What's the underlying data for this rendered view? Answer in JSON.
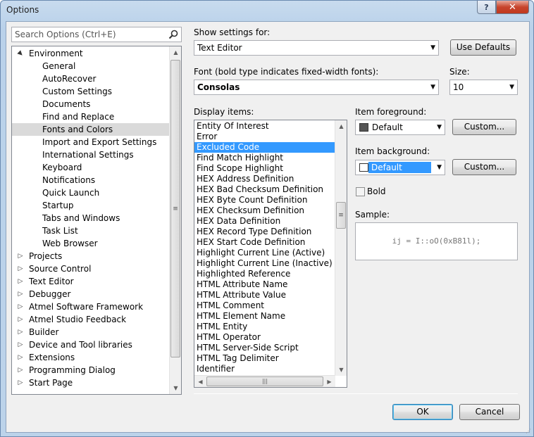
{
  "window": {
    "title": "Options"
  },
  "titlebar": {
    "help_label": "?",
    "close_label": "✕"
  },
  "search": {
    "placeholder": "Search Options (Ctrl+E)"
  },
  "tree": {
    "items": [
      {
        "label": "Environment",
        "level": 0,
        "expander": "▲"
      },
      {
        "label": "General",
        "level": 1
      },
      {
        "label": "AutoRecover",
        "level": 1
      },
      {
        "label": "Custom Settings",
        "level": 1
      },
      {
        "label": "Documents",
        "level": 1
      },
      {
        "label": "Find and Replace",
        "level": 1
      },
      {
        "label": "Fonts and Colors",
        "level": 1,
        "selected": true
      },
      {
        "label": "Import and Export Settings",
        "level": 1
      },
      {
        "label": "International Settings",
        "level": 1
      },
      {
        "label": "Keyboard",
        "level": 1
      },
      {
        "label": "Notifications",
        "level": 1
      },
      {
        "label": "Quick Launch",
        "level": 1
      },
      {
        "label": "Startup",
        "level": 1
      },
      {
        "label": "Tabs and Windows",
        "level": 1
      },
      {
        "label": "Task List",
        "level": 1
      },
      {
        "label": "Web Browser",
        "level": 1
      },
      {
        "label": "Projects",
        "level": 0,
        "expander": "▷"
      },
      {
        "label": "Source Control",
        "level": 0,
        "expander": "▷"
      },
      {
        "label": "Text Editor",
        "level": 0,
        "expander": "▷"
      },
      {
        "label": "Debugger",
        "level": 0,
        "expander": "▷"
      },
      {
        "label": "Atmel Software Framework",
        "level": 0,
        "expander": "▷"
      },
      {
        "label": "Atmel Studio Feedback",
        "level": 0,
        "expander": "▷"
      },
      {
        "label": "Builder",
        "level": 0,
        "expander": "▷"
      },
      {
        "label": "Device and Tool libraries",
        "level": 0,
        "expander": "▷"
      },
      {
        "label": "Extensions",
        "level": 0,
        "expander": "▷"
      },
      {
        "label": "Programming Dialog",
        "level": 0,
        "expander": "▷"
      },
      {
        "label": "Start Page",
        "level": 0,
        "expander": "▷"
      }
    ]
  },
  "settings": {
    "show_for_label": "Show settings for:",
    "show_for_value": "Text Editor",
    "use_defaults": "Use Defaults",
    "font_label": "Font (bold type indicates fixed-width fonts):",
    "font_value": "Consolas",
    "size_label": "Size:",
    "size_value": "10",
    "display_items_label": "Display items:",
    "display_items": [
      "Entity Of Interest",
      "Error",
      "Excluded Code",
      "Find Match Highlight",
      "Find Scope Highlight",
      "HEX Address Definition",
      "HEX Bad Checksum Definition",
      "HEX Byte Count Definition",
      "HEX Checksum Definition",
      "HEX Data Definition",
      "HEX Record Type Definition",
      "HEX Start Code Definition",
      "Highlight Current Line (Active)",
      "Highlight Current Line (Inactive)",
      "Highlighted Reference",
      "HTML Attribute Name",
      "HTML Attribute Value",
      "HTML Comment",
      "HTML Element Name",
      "HTML Entity",
      "HTML Operator",
      "HTML Server-Side Script",
      "HTML Tag Delimiter",
      "Identifier"
    ],
    "selected_display_item": "Excluded Code",
    "fg_label": "Item foreground:",
    "fg_value": "Default",
    "fg_color": "#555555",
    "bg_label": "Item background:",
    "bg_value": "Default",
    "bg_color": "#ffffff",
    "custom_label": "Custom...",
    "bold_label": "Bold",
    "bold_checked": false,
    "sample_label": "Sample:",
    "sample_text": "ij = I::oO(0xB81l);"
  },
  "footer": {
    "ok": "OK",
    "cancel": "Cancel"
  },
  "colors": {
    "selection": "#3399ff",
    "tree_selection": "#dadada"
  }
}
